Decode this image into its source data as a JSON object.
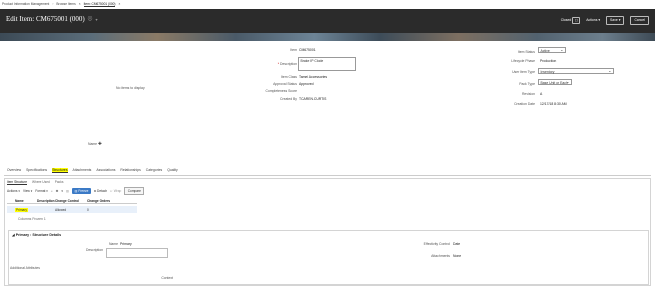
{
  "breadcrumbs": [
    "Product Information Management",
    "Browse Items",
    "Item: CM675001 (000)"
  ],
  "header": {
    "title": "Edit Item: CM675001 (000)",
    "closed_label": "Closed",
    "actions_label": "Actions",
    "save_label": "Save",
    "cancel_label": "Cancel"
  },
  "image_panel": {
    "no_items_text": "No items to display",
    "name_label": "Name"
  },
  "item_fields": {
    "item_label": "Item",
    "item_value": "CM675001",
    "description_label": "Description",
    "description_value": "Brake IP Clode",
    "item_class_label": "Item Class",
    "item_class_value": "Tamei Accessories",
    "approval_status_label": "Approval Status",
    "approval_status_value": "Approved",
    "completeness_label": "Completeness Score",
    "completeness_value": "",
    "created_by_label": "Created By",
    "created_by_value": "TCAREN.CURTIS"
  },
  "status_fields": {
    "item_status_label": "Item Status",
    "item_status_value": "Active",
    "lifecycle_label": "Lifecycle Phase",
    "lifecycle_value": "Production",
    "user_item_type_label": "User Item Type",
    "user_item_type_value": "Inventory",
    "pack_type_label": "Pack Type",
    "pack_type_value": "Base Unit or Each",
    "revision_label": "Revision",
    "revision_value": "A",
    "creation_date_label": "Creation Date",
    "creation_date_value": "12/17/18 8:30 AM"
  },
  "tabs": [
    "Overview",
    "Specifications",
    "Structures",
    "Attachments",
    "Associations",
    "Relationships",
    "Categories",
    "Quality"
  ],
  "subtabs": [
    "Item Structure",
    "Where Used",
    "Packs"
  ],
  "toolbar": {
    "actions_label": "Actions",
    "view_label": "View",
    "format_label": "Format",
    "freeze_label": "Freeze",
    "detach_label": "Detach",
    "wrap_label": "Wrap",
    "compare_label": "Compare"
  },
  "table": {
    "headers": [
      "Name",
      "Description",
      "Change Control",
      "Change Orders"
    ],
    "row": {
      "name": "Primary",
      "description": "",
      "change_control": "Allowed",
      "change_orders": "0"
    },
    "footer": "Columns Frozen 1"
  },
  "details": {
    "title": "Primary : Structure Details",
    "name_label": "Name",
    "name_value": "Primary",
    "description_label": "Description",
    "effectivity_label": "Effectivity Control",
    "effectivity_value": "Date",
    "attachments_label": "Attachments",
    "attachments_value": "None",
    "additional_label": "Additional Attributes",
    "context_label": "Context"
  }
}
